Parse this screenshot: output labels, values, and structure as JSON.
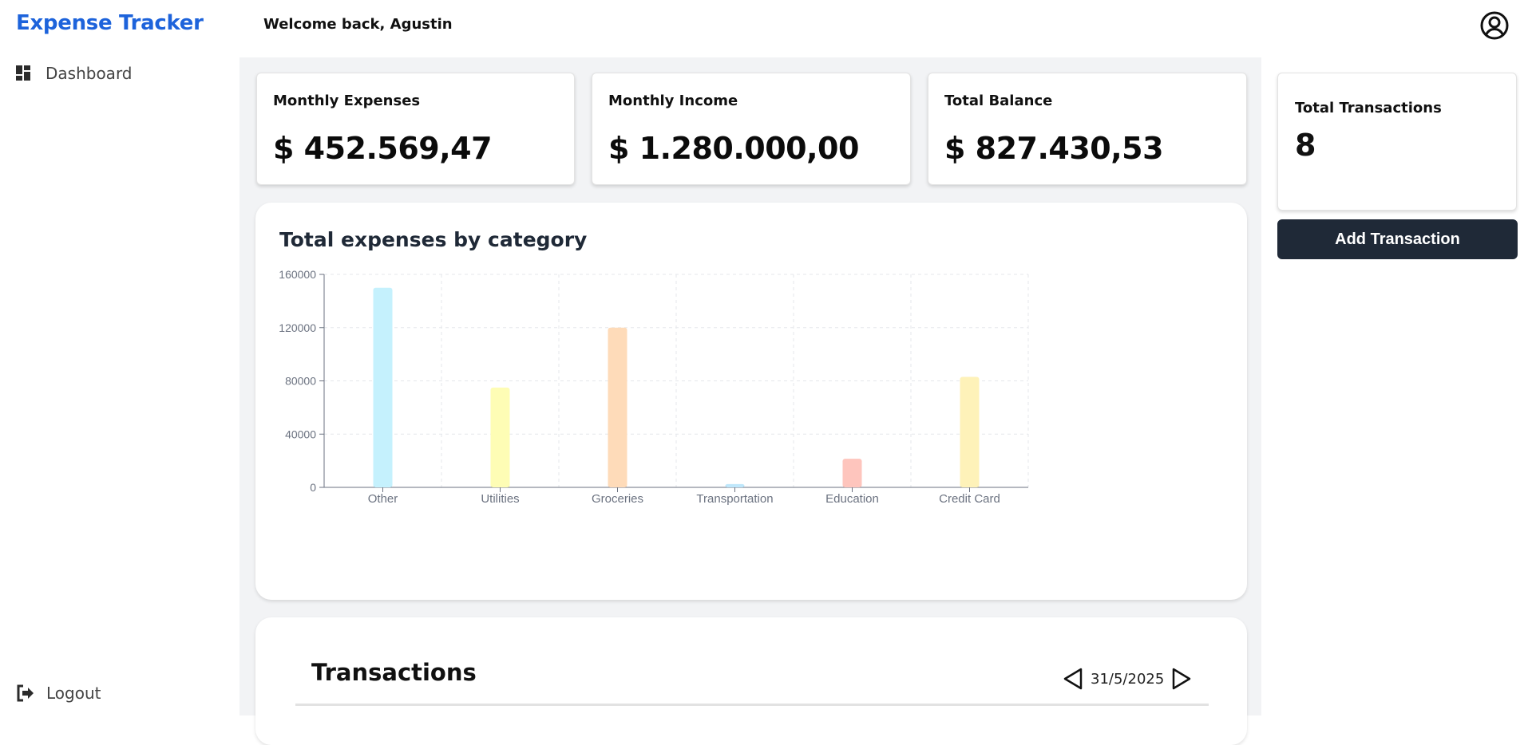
{
  "app": {
    "title": "Expense Tracker"
  },
  "sidebar": {
    "items": [
      {
        "label": "Dashboard",
        "icon": "dashboard-icon"
      }
    ],
    "logout_label": "Logout"
  },
  "header": {
    "welcome": "Welcome back, Agustin"
  },
  "summary": {
    "monthly_expenses": {
      "label": "Monthly Expenses",
      "value": "$ 452.569,47"
    },
    "monthly_income": {
      "label": "Monthly Income",
      "value": "$ 1.280.000,00"
    },
    "total_balance": {
      "label": "Total Balance",
      "value": "$ 827.430,53"
    }
  },
  "stats": {
    "total_transactions_label": "Total Transactions",
    "total_transactions_value": "8"
  },
  "actions": {
    "add_transaction_label": "Add Transaction"
  },
  "transactions": {
    "title": "Transactions",
    "date": "31/5/2025"
  },
  "chart_data": {
    "type": "bar",
    "title": "Total expenses by category",
    "xlabel": "",
    "ylabel": "",
    "categories": [
      "Other",
      "Utilities",
      "Groceries",
      "Transportation",
      "Education",
      "Credit Card"
    ],
    "values": [
      150000,
      75000,
      120000,
      2500,
      21500,
      83000
    ],
    "colors": [
      "#c5f1fd",
      "#fefdb5",
      "#fedbb9",
      "#bfe7fb",
      "#fec5bd",
      "#fef2b9"
    ],
    "ylim": [
      0,
      160000
    ],
    "yticks": [
      "160000",
      "120000",
      "80000",
      "40000",
      "0"
    ],
    "grid": true
  }
}
